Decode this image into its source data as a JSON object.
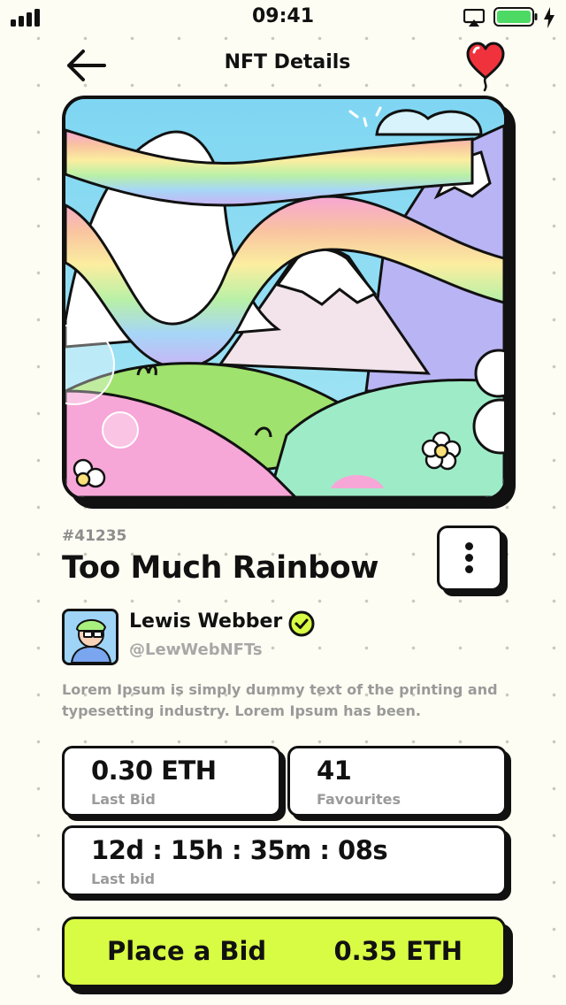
{
  "status_bar": {
    "time": "09:41",
    "battery_color": "#4cd964"
  },
  "header": {
    "title": "NFT Details",
    "back_icon": "arrow-left-icon",
    "favorite_icon": "heart-balloon-icon"
  },
  "nft": {
    "token_id": "#41235",
    "title": "Too Much Rainbow",
    "creator": {
      "name": "Lewis Webber",
      "handle": "@LewWebNFTs",
      "verified": true
    },
    "description": "Lorem Ipsum is simply dummy text of the printing and typesetting industry. Lorem Ipsum has been."
  },
  "stats": {
    "last_bid": {
      "value": "0.30 ETH",
      "label": "Last Bid"
    },
    "favourites": {
      "value": "41",
      "label": "Favourites"
    },
    "timer": {
      "value": "12d : 15h : 35m : 08s",
      "label": "Last bid"
    }
  },
  "action": {
    "label": "Place a Bid",
    "price": "0.35 ETH",
    "color": "#d8fc43"
  },
  "colors": {
    "accent": "#d8fc43",
    "heart": "#f0323c",
    "text": "#111111",
    "muted": "#9a9a9a"
  }
}
